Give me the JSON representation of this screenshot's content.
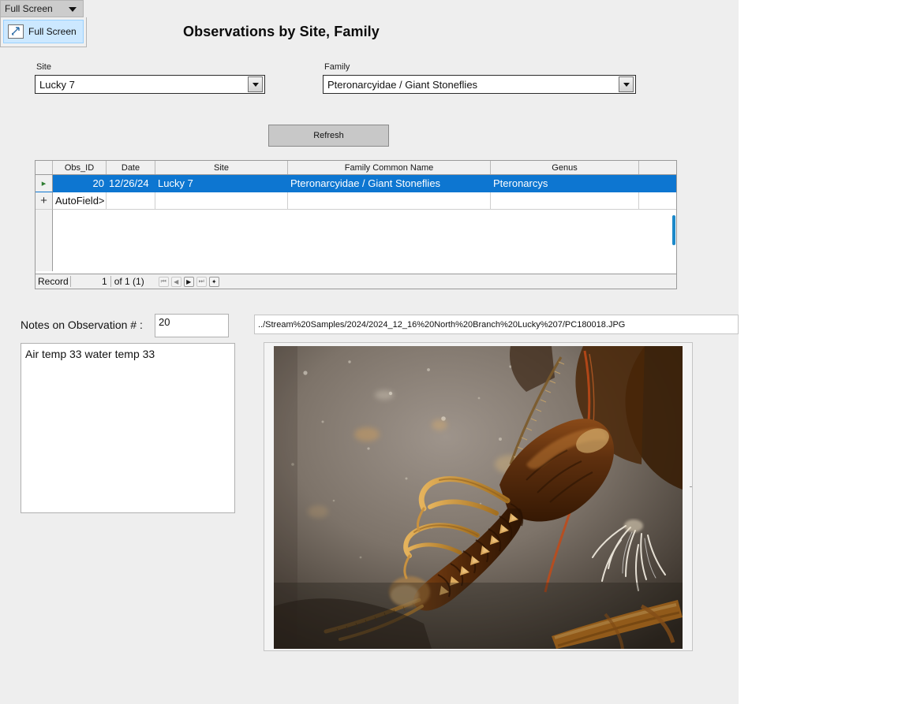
{
  "window": {
    "fullscreen_combo": {
      "value": "Full Screen",
      "caret_icon": "chevron-down-icon",
      "menu_item_label": "Full Screen",
      "menu_item_icon": "fullscreen-arrow-icon"
    }
  },
  "header": {
    "title": "Observations by Site, Family"
  },
  "filters": {
    "site": {
      "label": "Site",
      "value": "Lucky 7",
      "dropdown_icon": "chevron-down-icon"
    },
    "family": {
      "label": "Family",
      "value": "Pteronarcyidae / Giant Stoneflies",
      "dropdown_icon": "chevron-down-icon"
    },
    "refresh_label": "Refresh"
  },
  "grid": {
    "columns": [
      "",
      "Obs_ID",
      "Date",
      "Site",
      "Family Common Name",
      "Genus",
      ""
    ],
    "rows": [
      {
        "indicator": "▸",
        "obs_id": "20",
        "date": "12/26/24",
        "site": "Lucky 7",
        "family_common_name": "Pteronarcyidae / Giant Stoneflies",
        "genus": "Pteronarcys",
        "selected": true
      },
      {
        "indicator": "+",
        "obs_id": "AutoField>",
        "date": "",
        "site": "",
        "family_common_name": "",
        "genus": "",
        "selected": false
      }
    ],
    "footer": {
      "record_label": "Record",
      "record_number": "1",
      "record_of": "of 1 (1)",
      "nav": [
        {
          "name": "first-record-button",
          "glyph": "⏮"
        },
        {
          "name": "previous-record-button",
          "glyph": "◀"
        },
        {
          "name": "next-record-button",
          "glyph": "▶"
        },
        {
          "name": "last-record-button",
          "glyph": "⏭"
        },
        {
          "name": "new-record-button",
          "glyph": "✦"
        }
      ]
    }
  },
  "notes": {
    "label": "Notes on Observation # :",
    "observation_number": "20",
    "text": "Air temp 33 water temp 33"
  },
  "image": {
    "path": "../Stream%20Samples/2024/2024_12_16%20North%20Branch%20Lucky%207/PC180018.JPG",
    "alt_name": "stonefly-nymph-macro-photo"
  },
  "colors": {
    "form_background": "#eeeeee",
    "selection_blue": "#0d76d1",
    "scrollbar_blue": "#1c89c9",
    "menu_highlight": "#cce8ff",
    "button_gray": "#c8c8c8"
  }
}
